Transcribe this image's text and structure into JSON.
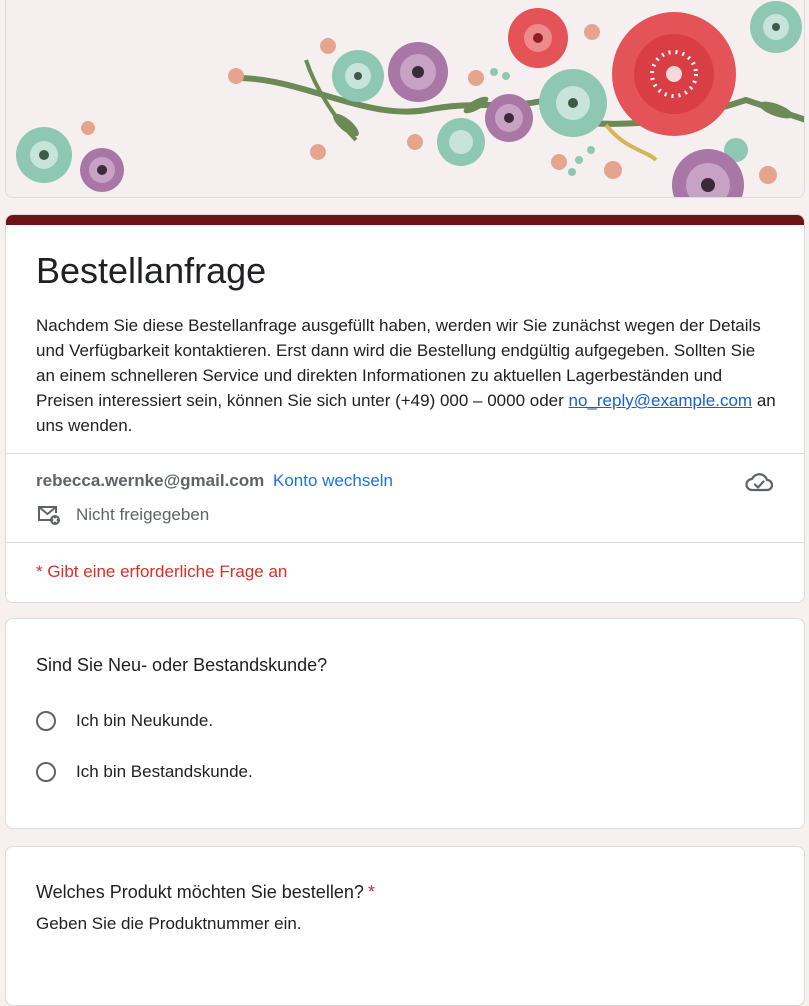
{
  "form": {
    "title": "Bestellanfrage",
    "description_prefix": "Nachdem Sie diese Bestellanfrage ausgefüllt haben, werden wir Sie zunächst wegen der Details und Verfügbarkeit kontaktieren. Erst dann wird die Bestellung endgültig aufgegeben. Sollten Sie an einem schnelleren Service und direkten Informationen zu aktuellen Lagerbeständen und Preisen interessiert sein, können Sie sich unter (+49) 000 – 0000 oder ",
    "description_link": "no_reply@example.com",
    "description_suffix": " an uns wenden.",
    "theme_color": "#6e1414"
  },
  "account": {
    "email": "rebecca.wernke@gmail.com",
    "switch_label": "Konto wechseln",
    "share_status": "Nicht freigegeben",
    "cloud_icon": "cloud-check-icon",
    "share_icon": "mail-off-icon"
  },
  "required_note": "* Gibt eine erforderliche Frage an",
  "questions": [
    {
      "title": "Sind Sie Neu- oder Bestandskunde?",
      "options": [
        "Ich bin Neukunde.",
        "Ich bin Bestandskunde."
      ]
    },
    {
      "title": "Welches Produkt möchten Sie bestellen?",
      "required_marker": "*",
      "hint": "Geben Sie die Produktnummer ein."
    }
  ]
}
